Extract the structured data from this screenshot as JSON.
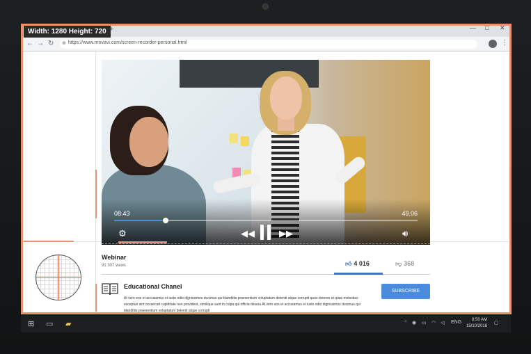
{
  "overlay": {
    "dimensions_label": "Width: 1280  Height: 720"
  },
  "browser": {
    "new_tab": "+",
    "url": "https://www.movavi.com/screen-recorder-personal.html",
    "controls": {
      "minimize": "—",
      "maximize": "□",
      "close": "✕"
    }
  },
  "player": {
    "current_time": "08.43",
    "duration": "49.06",
    "progress_fraction": 0.17
  },
  "video": {
    "title": "Webinar",
    "views": "91 307 views",
    "likes": "4 016",
    "dislikes": "368"
  },
  "channel": {
    "name": "Educational Chanel",
    "subscribe_label": "SUBSCRIBE",
    "description": "At vero eos et accusamus et iusto odio dignissimos ducimus qui blanditiis praesentium voluptatum deleniti atque corrupti quos dolores et quas molestias excepturi sint occaecati cupiditate non provident, similique sunt in culpa qui officia deseru At vero eos et accusamus et iusto odio dignissimos ducimus qui blanditiis praesentium voluptatum deleniti atque corrupti"
  },
  "taskbar": {
    "language": "ENG",
    "time": "8:50 AM",
    "date": "15/10/2018"
  },
  "colors": {
    "accent_orange": "#e8916f",
    "link_blue": "#4a8bdc"
  }
}
